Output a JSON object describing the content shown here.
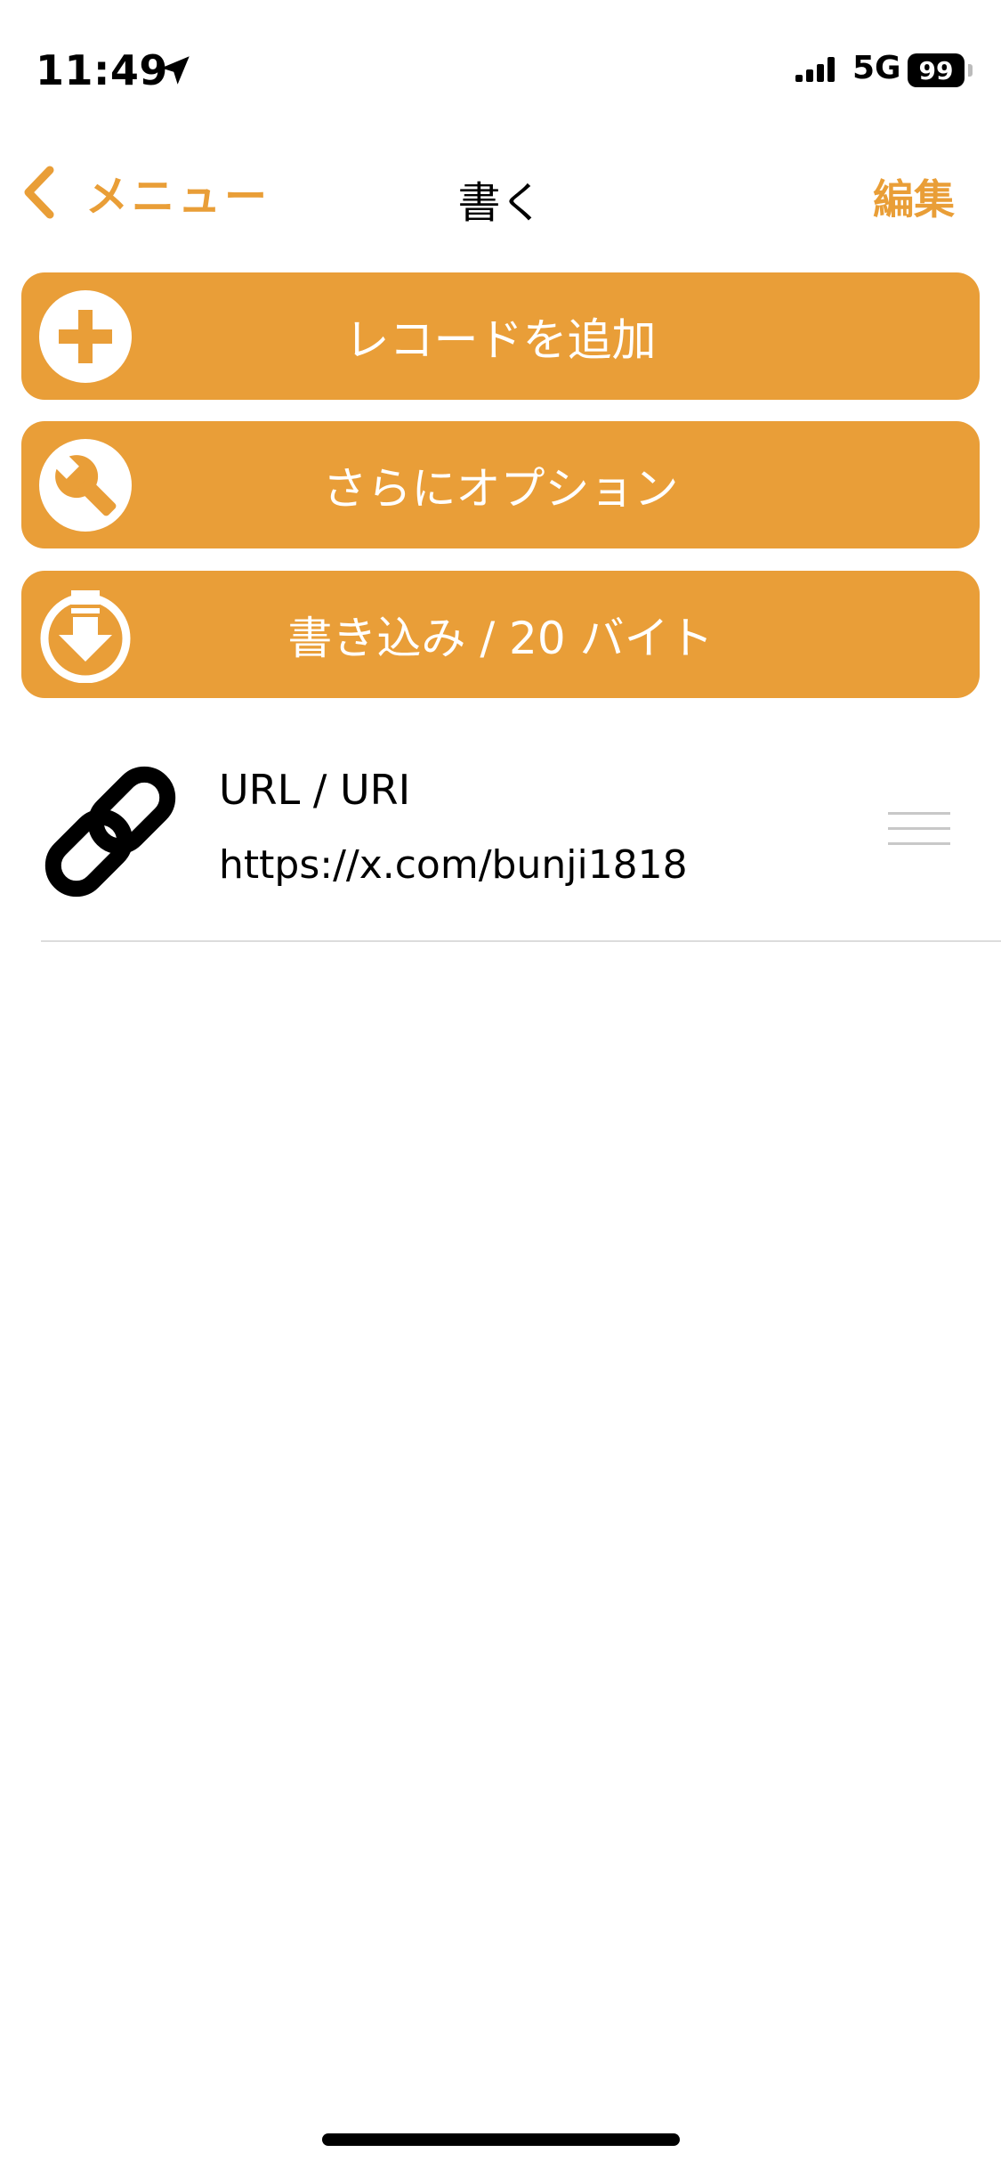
{
  "status": {
    "time": "11:49",
    "network": "5G",
    "battery": "99"
  },
  "nav": {
    "back_label": "メニュー",
    "title": "書く",
    "edit_label": "編集"
  },
  "actions": [
    {
      "label": "レコードを追加",
      "icon": "plus-circle-icon"
    },
    {
      "label": "さらにオプション",
      "icon": "wrench-icon"
    },
    {
      "label": "書き込み / 20 バイト",
      "icon": "download-write-icon"
    }
  ],
  "records": [
    {
      "type": "URL / URI",
      "value": "https://x.com/bunji1818",
      "icon": "link-icon"
    }
  ],
  "colors": {
    "accent": "#e99e38",
    "background": "#ffffff",
    "divider": "#dcdcdc"
  }
}
